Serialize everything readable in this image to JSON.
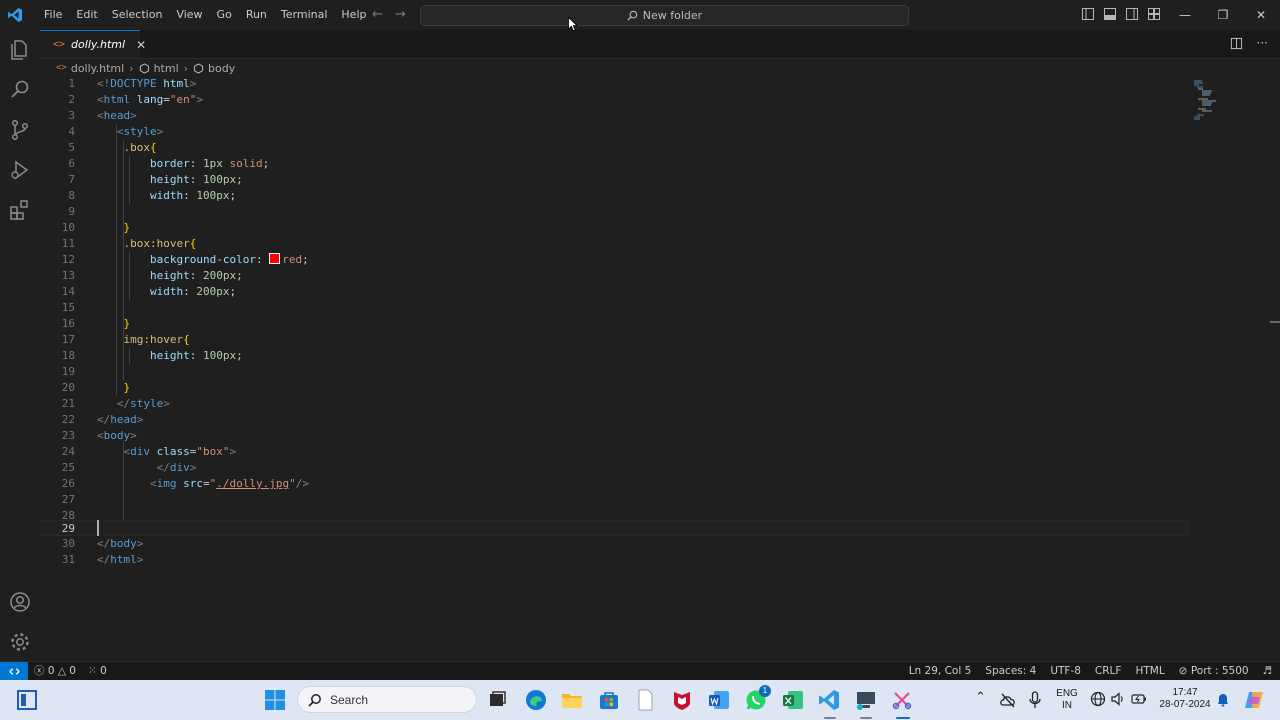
{
  "menu": [
    "File",
    "Edit",
    "Selection",
    "View",
    "Go",
    "Run",
    "Terminal",
    "Help"
  ],
  "command_center": {
    "label": "New folder"
  },
  "tab": {
    "label": "dolly.html",
    "icon_text": "<>"
  },
  "breadcrumb": {
    "file": "dolly.html",
    "html": "html",
    "body": "body"
  },
  "editor": {
    "line_numbers": [
      "1",
      "2",
      "3",
      "4",
      "5",
      "6",
      "7",
      "8",
      "9",
      "10",
      "11",
      "12",
      "13",
      "14",
      "15",
      "16",
      "17",
      "18",
      "19",
      "20",
      "21",
      "22",
      "23",
      "24",
      "25",
      "26",
      "27",
      "28",
      "29",
      "30",
      "31"
    ],
    "active_line": 29
  },
  "status": {
    "errors": "0",
    "warnings": "0",
    "ports": "0",
    "position": "Ln 29, Col 5",
    "spaces": "Spaces: 4",
    "encoding": "UTF-8",
    "eol": "CRLF",
    "language": "HTML",
    "port": "Port : 5500"
  },
  "taskbar": {
    "search_placeholder": "Search",
    "whatsapp_badge": "1",
    "lang_top": "ENG",
    "lang_bottom": "IN",
    "time": "17:47",
    "date": "28-07-2024"
  },
  "colors": {
    "accent": "#0078d4",
    "swatch_red": "#ff0000"
  }
}
